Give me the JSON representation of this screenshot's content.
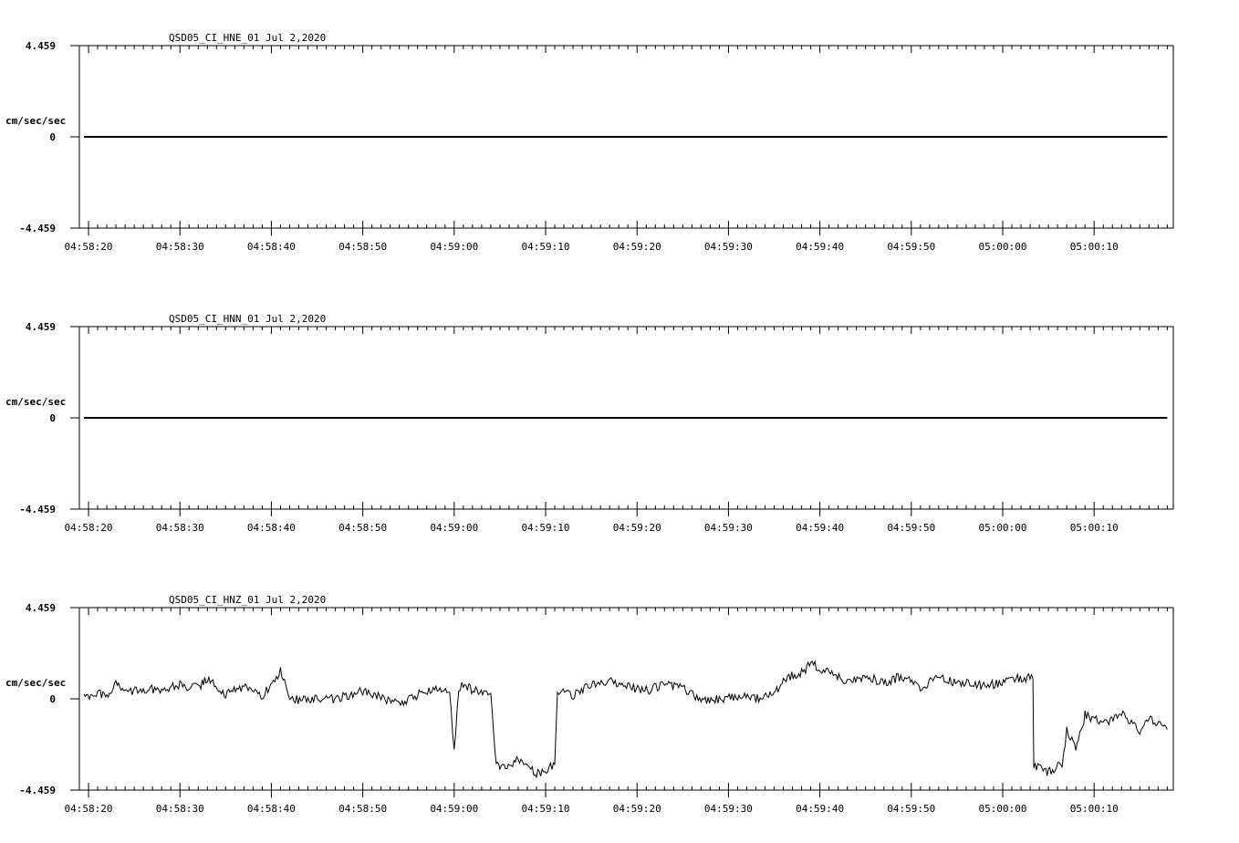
{
  "chart_data": [
    {
      "type": "line",
      "title": "QSD05_CI_HNE_01  Jul 2,2020",
      "ylabel": "cm/sec/sec",
      "ylim": [
        -4.459,
        4.459
      ],
      "y_ticks": [
        "4.459",
        "0",
        "-4.459"
      ],
      "x_ticks": [
        "04:58:20",
        "04:58:30",
        "04:58:40",
        "04:58:50",
        "04:59:00",
        "04:59:10",
        "04:59:20",
        "04:59:30",
        "04:59:40",
        "04:59:50",
        "05:00:00",
        "05:00:10"
      ],
      "series": [
        {
          "x": [
            "04:58:19.5",
            "05:00:18"
          ],
          "y": [
            0,
            0
          ]
        }
      ]
    },
    {
      "type": "line",
      "title": "QSD05_CI_HNN_01  Jul 2,2020",
      "ylabel": "cm/sec/sec",
      "ylim": [
        -4.459,
        4.459
      ],
      "y_ticks": [
        "4.459",
        "0",
        "-4.459"
      ],
      "x_ticks": [
        "04:58:20",
        "04:58:30",
        "04:58:40",
        "04:58:50",
        "04:59:00",
        "04:59:10",
        "04:59:20",
        "04:59:30",
        "04:59:40",
        "04:59:50",
        "05:00:00",
        "05:00:10"
      ],
      "series": [
        {
          "x": [
            "04:58:19.5",
            "05:00:18"
          ],
          "y": [
            0,
            0
          ]
        }
      ]
    },
    {
      "type": "line",
      "title": "QSD05_CI_HNZ_01  Jul 2,2020",
      "ylabel": "cm/sec/sec",
      "ylim": [
        -4.459,
        4.459
      ],
      "y_ticks": [
        "4.459",
        "0",
        "-4.459"
      ],
      "x_ticks": [
        "04:58:20",
        "04:58:30",
        "04:58:40",
        "04:58:50",
        "04:59:00",
        "04:59:10",
        "04:59:20",
        "04:59:30",
        "04:59:40",
        "04:59:50",
        "05:00:00",
        "05:00:10"
      ],
      "series": [
        {
          "x": [
            "04:58:19.5",
            "04:58:21",
            "04:58:22",
            "04:58:23",
            "04:58:24",
            "04:58:26",
            "04:58:28",
            "04:58:30",
            "04:58:32",
            "04:58:33",
            "04:58:35",
            "04:58:37",
            "04:58:39",
            "04:58:41",
            "04:58:42",
            "04:58:44",
            "04:58:46",
            "04:58:48",
            "04:58:50",
            "04:58:52",
            "04:58:54",
            "04:58:56",
            "04:58:58",
            "04:58:59.5",
            "04:59:00",
            "04:59:00.5",
            "04:59:01",
            "04:59:04",
            "04:59:04.6",
            "04:59:05",
            "04:59:07",
            "04:59:09",
            "04:59:11",
            "04:59:11.3",
            "04:59:13",
            "04:59:15",
            "04:59:17",
            "04:59:19",
            "04:59:21",
            "04:59:23",
            "04:59:25",
            "04:59:27",
            "04:59:29",
            "04:59:31",
            "04:59:33",
            "04:59:35",
            "04:59:36",
            "04:59:38",
            "04:59:39",
            "04:59:41",
            "04:59:43",
            "04:59:45",
            "04:59:47",
            "04:59:49",
            "04:59:51",
            "04:59:53",
            "04:59:55",
            "04:59:57",
            "04:59:59",
            "05:00:01",
            "05:00:03.3",
            "05:00:03.4",
            "05:00:05",
            "05:00:06.5",
            "05:00:07",
            "05:00:08",
            "05:00:09",
            "05:00:11",
            "05:00:13",
            "05:00:15",
            "05:00:16",
            "05:00:18"
          ],
          "y": [
            0.1,
            0.35,
            0.1,
            0.75,
            0.4,
            0.4,
            0.5,
            0.65,
            0.55,
            1.0,
            0.25,
            0.6,
            0.1,
            1.4,
            -0.1,
            0.05,
            -0.05,
            0.1,
            0.4,
            0.05,
            -0.2,
            0.2,
            0.6,
            0.3,
            -2.5,
            0.6,
            0.6,
            0.2,
            -3.2,
            -3.4,
            -3.0,
            -3.7,
            -3.2,
            0.4,
            0.2,
            0.7,
            0.9,
            0.6,
            0.4,
            0.7,
            0.5,
            -0.1,
            0.0,
            0.1,
            0.0,
            0.2,
            1.0,
            1.3,
            1.7,
            1.3,
            0.9,
            1.1,
            0.8,
            1.1,
            0.6,
            1.0,
            0.8,
            0.7,
            0.7,
            1.0,
            1.0,
            -3.3,
            -3.6,
            -3.2,
            -1.5,
            -2.5,
            -0.8,
            -1.2,
            -0.7,
            -1.5,
            -1.0,
            -1.5
          ]
        }
      ]
    }
  ]
}
